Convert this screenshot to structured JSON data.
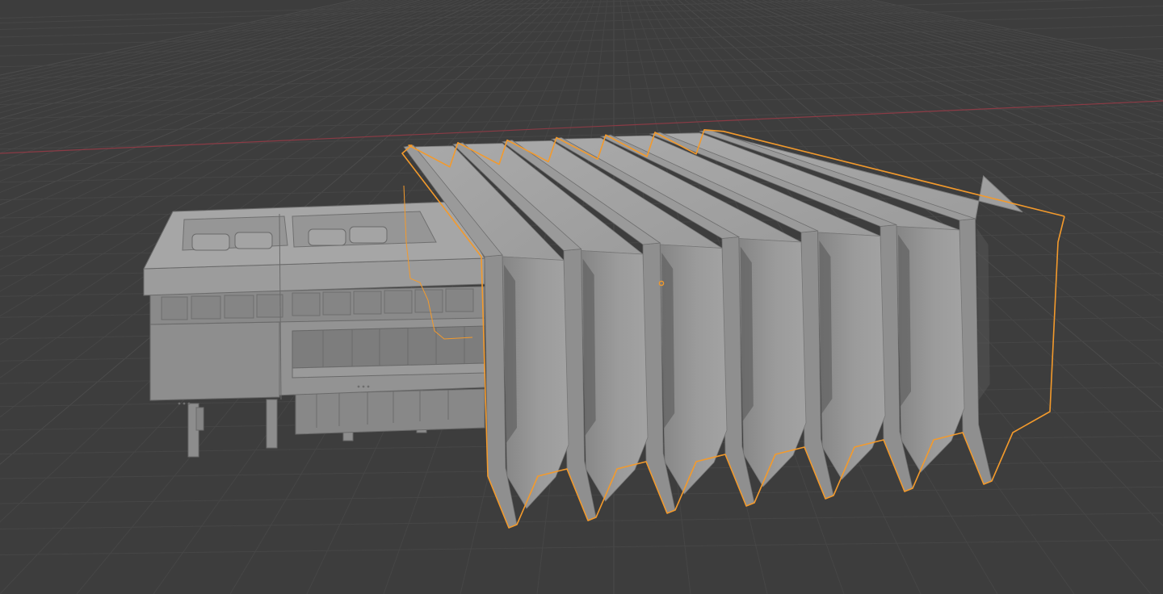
{
  "viewport": {
    "background": "#3d3d3d",
    "grid_color": "#464646",
    "grid_color_major": "#4b4b4b",
    "x_axis_color": "#8a3b45",
    "selection_outline_color": "#f39a2c",
    "building_color": "#8f8f8f"
  },
  "scene": {
    "objects": [
      {
        "name": "main-building",
        "selected": false
      },
      {
        "name": "sawtooth-roof-structure",
        "selected": true,
        "segments": 7
      }
    ],
    "origin_marker_color": "#f39a2c"
  }
}
